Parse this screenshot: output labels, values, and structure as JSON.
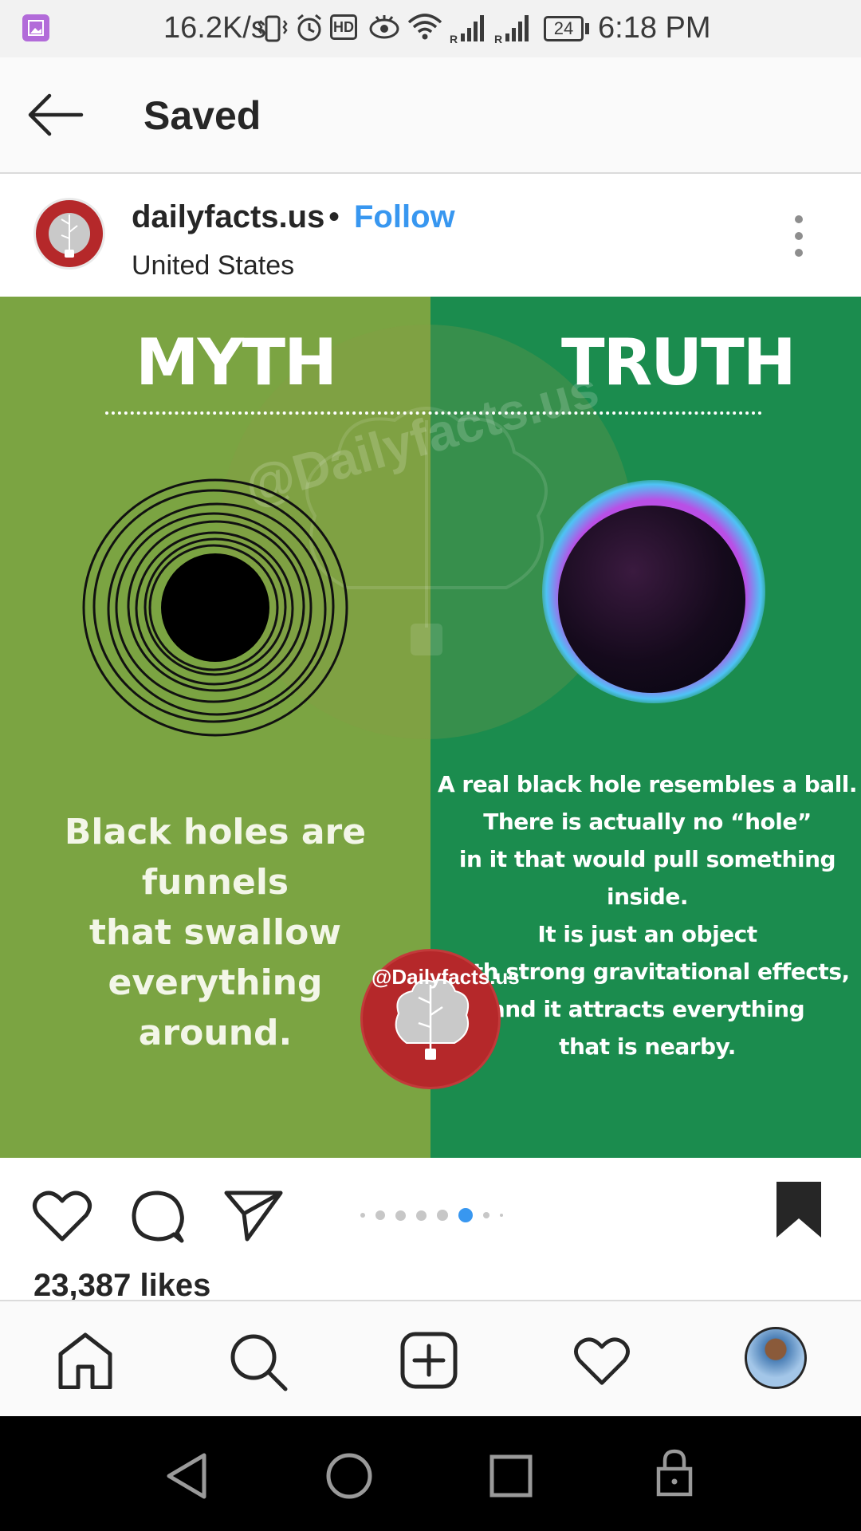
{
  "status_bar": {
    "speed": "16.2K/s",
    "battery": "24",
    "time": "6:18 PM",
    "hd_badge": "HD",
    "icons": [
      "gallery-icon",
      "vibrate-icon",
      "alarm-icon",
      "hd-icon",
      "eye-icon",
      "wifi-icon",
      "signal-icon",
      "signal-icon",
      "battery-icon"
    ]
  },
  "header": {
    "title": "Saved",
    "back_icon": "back-arrow-icon"
  },
  "post": {
    "username": "dailyfacts.us",
    "separator": "•",
    "follow_label": "Follow",
    "location": "United States",
    "image": {
      "left_heading": "MYTH",
      "right_heading": "TRUTH",
      "watermark": "@Dailyfacts.us",
      "myth_lines": [
        "Black holes are funnels",
        "that swallow everything",
        "around."
      ],
      "truth_lines": [
        "A real black hole resembles a ball.",
        "There is actually no “hole”",
        "in it that would pull something inside.",
        "It is just an object",
        "with strong gravitational effects,",
        "and it attracts everything",
        "that is nearby."
      ],
      "logo_text": "@Dailyfacts.us"
    },
    "carousel": {
      "count": 8,
      "active_index": 5
    },
    "likes": "23,387 likes"
  },
  "colors": {
    "follow": "#3897f0",
    "myth_bg": "#7ba442",
    "truth_bg": "#1b8c4e",
    "logo_red": "#b5282a",
    "carousel_active": "#3897f0"
  },
  "bottom_nav": [
    "home-icon",
    "search-icon",
    "add-post-icon",
    "activity-heart-icon",
    "profile-avatar"
  ],
  "system_nav": [
    "back-triangle-icon",
    "home-circle-icon",
    "recents-square-icon",
    "lock-icon"
  ]
}
